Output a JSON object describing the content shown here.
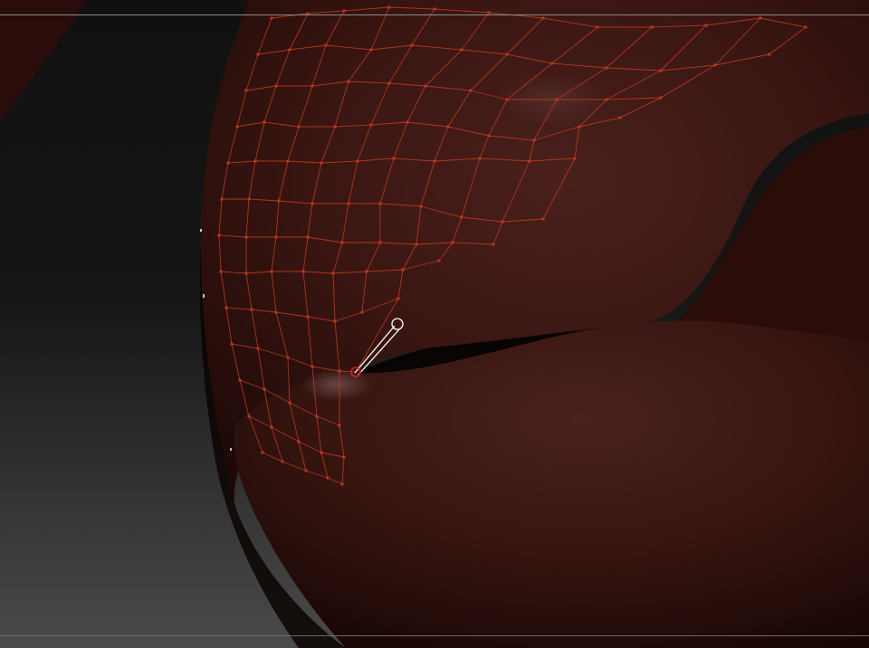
{
  "viewport": {
    "background_dark": "#111111",
    "background_light": "#4a4a4a",
    "mesh_color_base": "#3a1510",
    "mesh_color_highlight": "#5a2620",
    "wireframe_color": "#c23a22",
    "brush_cursor_color": "#ffffff",
    "brush_target_color": "#d0202a",
    "frame_line_color": "#8a8a8a"
  },
  "icons": {
    "brush_cursor": "brush-cursor-icon",
    "brush_target": "brush-target-icon"
  }
}
